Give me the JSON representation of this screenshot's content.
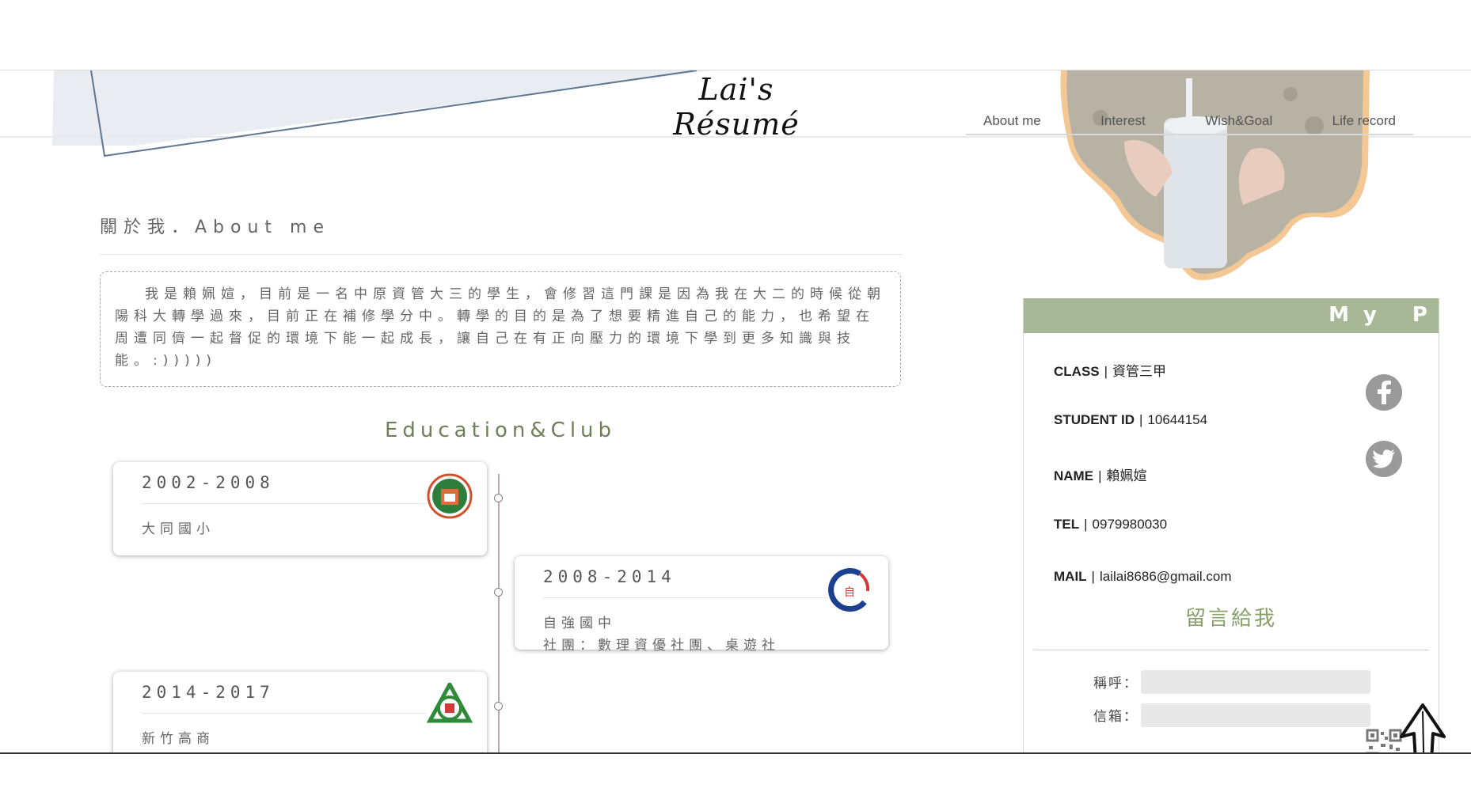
{
  "header": {
    "site_title": "Lai's Résumé",
    "nav": [
      "About me",
      "Interest",
      "Wish&Goal",
      "Life record"
    ]
  },
  "about": {
    "title": "關於我．About me",
    "intro": "我是賴姵媗，目前是一名中原資管大三的學生，會修習這門課是因為我在大二的時候從朝陽科大轉學過來，目前正在補修學分中。轉學的目的是為了想要精進自己的能力，也希望在周遭同儕一起督促的環境下能一起成長，讓自己在有正向壓力的環境下學到更多知識與技能。:)))))"
  },
  "education": {
    "title": "Education&Club",
    "items": [
      {
        "years": "2002-2008",
        "school": "大同國小",
        "club": ""
      },
      {
        "years": "2008-2014",
        "school": "自強國中",
        "club": "社團：數理資優社團、桌遊社"
      },
      {
        "years": "2014-2017",
        "school": "新竹高商",
        "club": ""
      }
    ]
  },
  "profile": {
    "header": "My P",
    "class_label": "CLASS",
    "class_value": "資管三甲",
    "id_label": "STUDENT ID",
    "id_value": "10644154",
    "name_label": "NAME",
    "name_value": "賴姵媗",
    "tel_label": "TEL",
    "tel_value": "0979980030",
    "mail_label": "MAIL",
    "mail_value": "lailai8686@gmail.com",
    "separator": "|"
  },
  "message": {
    "title": "留言給我",
    "name_label": "稱呼：",
    "email_label": "信箱："
  },
  "colors": {
    "accent": "#a8b896",
    "title_green": "#6e7f5a",
    "social_gray": "#9a9a9a"
  },
  "icons": [
    "facebook-icon",
    "twitter-icon",
    "qr-code-icon",
    "up-arrow-icon"
  ]
}
